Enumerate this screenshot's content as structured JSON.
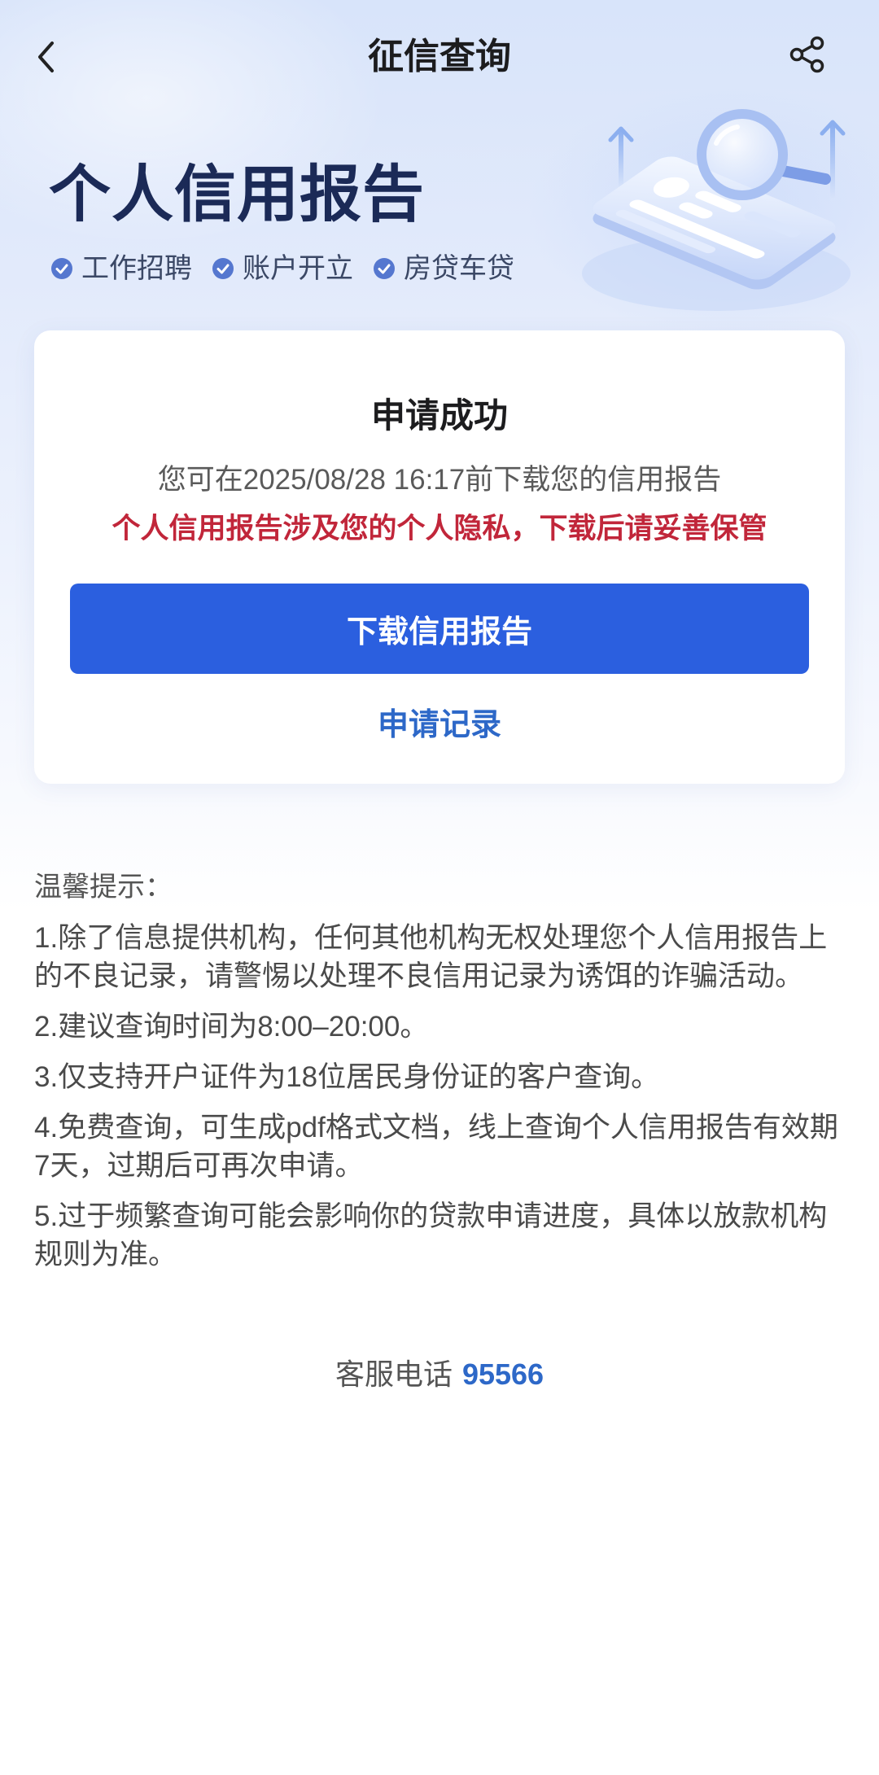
{
  "nav": {
    "title": "征信查询"
  },
  "icons": {
    "back": "chevron-left-icon",
    "share": "share-icon",
    "tag_check": "check-circle-icon",
    "illustration": "credit-report-magnifier-illustration"
  },
  "hero": {
    "title": "个人信用报告",
    "tags": [
      "工作招聘",
      "账户开立",
      "房贷车贷"
    ]
  },
  "card": {
    "status_title": "申请成功",
    "deadline_text": "您可在2025/08/28 16:17前下载您的信用报告",
    "privacy_warning": "个人信用报告涉及您的个人隐私，下载后请妥善保管",
    "download_button": "下载信用报告",
    "records_link": "申请记录"
  },
  "tips": {
    "heading": "温馨提示：",
    "items": [
      "1.除了信息提供机构，任何其他机构无权处理您个人信用报告上的不良记录，请警惕以处理不良信用记录为诱饵的诈骗活动。",
      "2.建议查询时间为8:00–20:00。",
      "3.仅支持开户证件为18位居民身份证的客户查询。",
      "4.免费查询，可生成pdf格式文档，线上查询个人信用报告有效期7天，过期后可再次申请。",
      "5.过于频繁查询可能会影响你的贷款申请进度，具体以放款机构规则为准。"
    ]
  },
  "service": {
    "label": "客服电话",
    "phone": "95566"
  },
  "colors": {
    "hero_title": "#1b2a57",
    "primary_button": "#2b5fdf",
    "link": "#2d68c8",
    "warning": "#c1263a",
    "tag_check": "#5577cf"
  }
}
